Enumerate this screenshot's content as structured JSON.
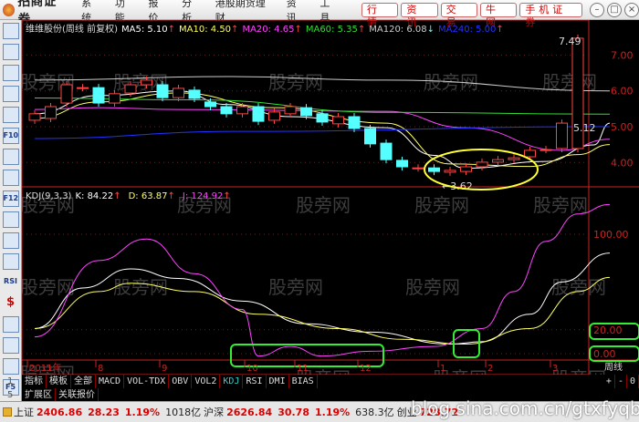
{
  "window": {
    "logo": "招商证券",
    "menus": [
      "系统",
      "功能",
      "报价",
      "分析",
      "港股期货理财",
      "资讯",
      "工具"
    ],
    "buttons": [
      "行情",
      "资讯",
      "交易",
      "牛网",
      "手机证券"
    ],
    "controls": [
      "–",
      "□",
      "×"
    ]
  },
  "toolbar": {
    "icons": [
      "quote-table-icon",
      "grid-icon",
      "line-chart-icon",
      "candle-icon",
      "window-icon",
      "F10",
      "tree-icon",
      "doc-icon",
      "F12",
      "fx-icon",
      "search-icon",
      "wave-icon",
      "RSI",
      "dollar-icon",
      "move-icon",
      "import-icon",
      "pencil-icon",
      "F5"
    ]
  },
  "main_panel": {
    "title": "维维股份(周线 前复权)",
    "ma": [
      {
        "label": "MA5: 5.10",
        "color": "#ffffff",
        "arrow": "↑"
      },
      {
        "label": "MA10: 4.50",
        "color": "#ffff66",
        "arrow": "↑"
      },
      {
        "label": "MA20: 4.65",
        "color": "#ff44ff",
        "arrow": "↑"
      },
      {
        "label": "MA60: 5.35",
        "color": "#33dd33",
        "arrow": "↑"
      },
      {
        "label": "MA120: 6.08",
        "color": "#cccccc",
        "arrow": "↓"
      },
      {
        "label": "MA240: 5.00",
        "color": "#2233ff",
        "arrow": "↑"
      }
    ],
    "high_label": "7.49",
    "low_label": "3.62",
    "last_label": "5.12"
  },
  "kdj_panel": {
    "title": "KDJ(9,3,3)",
    "k": "K: 84.22",
    "d": "D: 63.87",
    "j": "J: 124.92"
  },
  "date_axis": {
    "labels": [
      "2011年",
      "8",
      "9",
      "10",
      "11",
      "12",
      "1",
      "2",
      "3"
    ],
    "period": "周线"
  },
  "tabs": [
    "指标",
    "模板",
    "全部",
    "MACD",
    "VOL-TDX",
    "OBV",
    "VOL2",
    "KDJ",
    "RSI",
    "DMI",
    "BIAS"
  ],
  "active_tab": "KDJ",
  "tab_controls": [
    "+",
    "-",
    "0"
  ],
  "tabs2": [
    "扩展区",
    "关联报价"
  ],
  "left_nums": [
    "1",
    "5"
  ],
  "status": [
    {
      "name": "上证",
      "price": "2406.86",
      "chg": "28.23",
      "pct": "1.19%",
      "vol": "1018亿"
    },
    {
      "name": "沪深",
      "price": "2626.84",
      "chg": "30.78",
      "pct": "1.19%",
      "vol": "638.3亿"
    },
    {
      "name": "创业",
      "price": "728.72"
    }
  ],
  "watermark": "股旁网",
  "blog_watermark": "blog.sina.com.cn/gtxfyqb",
  "colors": {
    "up": "#ff4444",
    "down": "#55ffff",
    "axis": "#cc2222",
    "annotation_ellipse": "#ffff33",
    "annotation_box": "#33ee33"
  },
  "chart_data": [
    {
      "type": "candlestick",
      "price_axis": {
        "ticks": [
          "7.00",
          "6.00",
          "5.00",
          "4.00"
        ],
        "range": [
          3.4,
          7.7
        ]
      },
      "candles": [
        [
          5.18,
          5.36
        ],
        [
          5.23,
          5.56
        ],
        [
          5.66,
          6.17
        ],
        [
          6.09,
          6.09
        ],
        [
          6.09,
          5.66
        ],
        [
          5.66,
          5.92
        ],
        [
          5.94,
          6.17
        ],
        [
          6.17,
          6.3
        ],
        [
          6.17,
          5.81
        ],
        [
          5.81,
          6.07
        ],
        [
          6.02,
          5.79
        ],
        [
          5.69,
          5.56
        ],
        [
          5.56,
          5.36
        ],
        [
          5.36,
          5.56
        ],
        [
          5.56,
          5.15
        ],
        [
          5.18,
          5.41
        ],
        [
          5.36,
          5.56
        ],
        [
          5.53,
          5.31
        ],
        [
          5.36,
          5.13
        ],
        [
          5.08,
          5.28
        ],
        [
          5.28,
          4.95
        ],
        [
          4.95,
          4.52
        ],
        [
          4.54,
          4.08
        ],
        [
          4.06,
          3.88
        ],
        [
          3.85,
          3.85
        ],
        [
          3.85,
          3.75
        ],
        [
          3.73,
          3.78
        ],
        [
          3.75,
          3.88
        ],
        [
          3.88,
          4.01
        ],
        [
          4.01,
          4.08
        ],
        [
          4.08,
          4.13
        ],
        [
          4.16,
          4.34
        ],
        [
          4.36,
          4.36
        ],
        [
          4.39,
          5.1
        ],
        [
          4.39,
          7.47
        ]
      ],
      "ma_lines": {
        "MA5": [
          [
            0,
            5.36
          ],
          [
            4,
            5.87
          ],
          [
            9,
            6.0
          ],
          [
            12,
            5.62
          ],
          [
            16,
            5.28
          ],
          [
            22,
            4.97
          ],
          [
            25,
            4.2
          ],
          [
            27,
            3.84
          ],
          [
            32,
            4.03
          ],
          [
            35,
            4.49
          ],
          [
            36,
            5.1
          ]
        ],
        "MA10": [
          [
            0,
            5.23
          ],
          [
            4,
            5.69
          ],
          [
            9,
            5.94
          ],
          [
            15,
            5.53
          ],
          [
            22,
            5.1
          ],
          [
            26,
            3.96
          ],
          [
            31,
            3.89
          ],
          [
            34,
            4.22
          ],
          [
            36,
            4.5
          ]
        ],
        "MA20": [
          [
            0,
            5.48
          ],
          [
            4,
            5.53
          ],
          [
            9,
            5.48
          ],
          [
            22,
            5.43
          ],
          [
            27,
            4.97
          ],
          [
            33,
            4.34
          ],
          [
            36,
            4.65
          ]
        ],
        "MA60": [
          [
            0,
            5.8
          ],
          [
            10,
            5.75
          ],
          [
            22,
            5.4
          ],
          [
            36,
            5.35
          ]
        ],
        "MA120": [
          [
            0,
            6.3
          ],
          [
            12,
            6.4
          ],
          [
            22,
            6.3
          ],
          [
            36,
            6.0
          ]
        ],
        "MA240": [
          [
            0,
            4.67
          ],
          [
            13,
            4.87
          ],
          [
            36,
            5.0
          ]
        ]
      }
    },
    {
      "type": "line",
      "title": "KDJ(9,3,3)",
      "y_axis": {
        "ticks": [
          "100.00",
          "20.00",
          "0.00"
        ]
      },
      "series": [
        {
          "name": "K",
          "color": "#ffffff",
          "values": [
            [
              0,
              21
            ],
            [
              3,
              55
            ],
            [
              6,
              71
            ],
            [
              9,
              63
            ],
            [
              13,
              44
            ],
            [
              17,
              25
            ],
            [
              21,
              18
            ],
            [
              26,
              8
            ],
            [
              28,
              10
            ],
            [
              31,
              33
            ],
            [
              33,
              60
            ],
            [
              36,
              84.22
            ]
          ]
        },
        {
          "name": "D",
          "color": "#ffff66",
          "values": [
            [
              0,
              21
            ],
            [
              4,
              52
            ],
            [
              6,
              59
            ],
            [
              10,
              52
            ],
            [
              14,
              33
            ],
            [
              19,
              21
            ],
            [
              23,
              12
            ],
            [
              27,
              8
            ],
            [
              31,
              21
            ],
            [
              34,
              52
            ],
            [
              36,
              63.87
            ]
          ]
        },
        {
          "name": "J",
          "color": "#ff44ff",
          "values": [
            [
              0,
              14
            ],
            [
              4,
              78
            ],
            [
              7,
              96
            ],
            [
              10,
              67
            ],
            [
              13,
              37
            ],
            [
              14,
              -2
            ],
            [
              16,
              6
            ],
            [
              18,
              -2
            ],
            [
              21,
              2
            ],
            [
              25,
              6
            ],
            [
              28,
              21
            ],
            [
              30,
              52
            ],
            [
              32,
              94
            ],
            [
              34,
              117
            ],
            [
              36,
              124.92
            ]
          ]
        }
      ]
    }
  ]
}
